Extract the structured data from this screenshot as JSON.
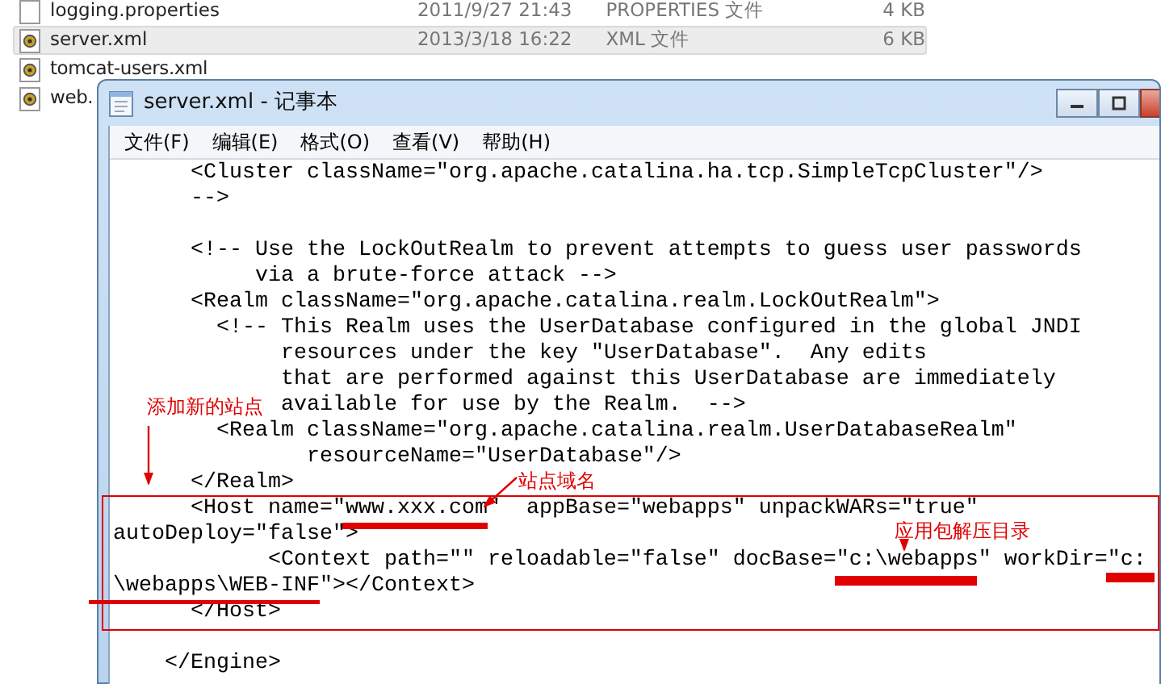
{
  "explorer": {
    "files": [
      {
        "name": "logging.properties",
        "modified": "2011/9/27 21:43",
        "type": "PROPERTIES 文件",
        "size": "4 KB",
        "selected": false,
        "kind": "text"
      },
      {
        "name": "server.xml",
        "modified": "2013/3/18 16:22",
        "type": "XML 文件",
        "size": "6 KB",
        "selected": true,
        "kind": "xml"
      },
      {
        "name": "tomcat-users.xml",
        "selected": false,
        "kind": "xml"
      },
      {
        "name": "web.",
        "selected": false,
        "kind": "xml"
      }
    ]
  },
  "window": {
    "title": "server.xml - 记事本",
    "menu": [
      "文件(F)",
      "编辑(E)",
      "格式(O)",
      "查看(V)",
      "帮助(H)"
    ]
  },
  "editor": {
    "blocks": [
      [
        "      <Cluster className=\"org.apache.catalina.ha.tcp.SimpleTcpCluster\"/>",
        "      -->"
      ],
      [
        "      <!-- Use the LockOutRealm to prevent attempts to guess user passwords",
        "           via a brute-force attack -->",
        "      <Realm className=\"org.apache.catalina.realm.LockOutRealm\">",
        "        <!-- This Realm uses the UserDatabase configured in the global JNDI",
        "             resources under the key \"UserDatabase\".  Any edits",
        "             that are performed against this UserDatabase are immediately",
        "             available for use by the Realm.  -->",
        "        <Realm className=\"org.apache.catalina.realm.UserDatabaseRealm\"",
        "               resourceName=\"UserDatabase\"/>",
        "      </Realm>",
        "      <Host name=\"www.xxx.com\"  appBase=\"webapps\" unpackWARs=\"true\"",
        "autoDeploy=\"false\">",
        "            <Context path=\"\" reloadable=\"false\" docBase=\"c:\\webapps\" workDir=\"c:",
        "\\webapps\\WEB-INF\"></Context>",
        "      </Host>"
      ],
      [
        "    </Engine>"
      ]
    ]
  },
  "annotations": [
    "添加新的站点",
    "站点域名",
    "应用包解压目录"
  ]
}
